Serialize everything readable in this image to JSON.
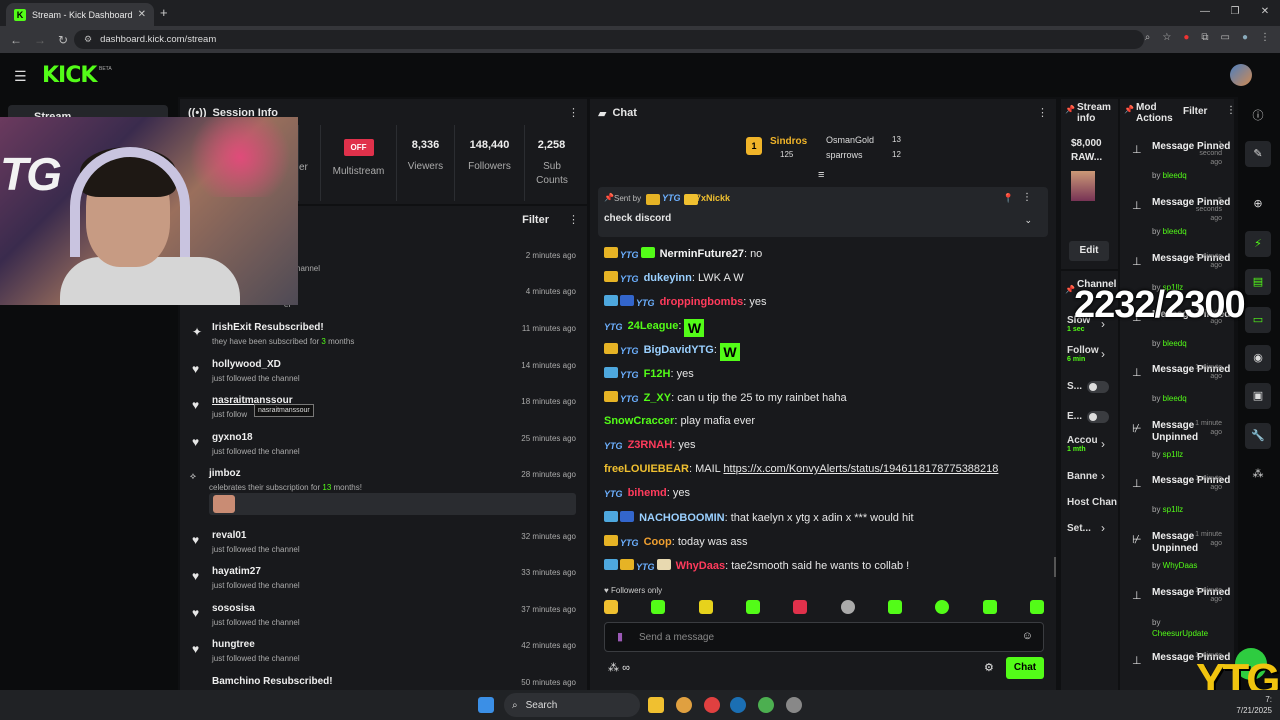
{
  "browser": {
    "tab_title": "Stream - Kick Dashboard",
    "url": "dashboard.kick.com/stream"
  },
  "header": {
    "logo": "KICK",
    "beta": "BETA"
  },
  "nav": {
    "stream": "Stream"
  },
  "webcam": {
    "overlay_text": "TG"
  },
  "session": {
    "title": "Session Info",
    "clipped_label": "er",
    "multistream_badge": "OFF",
    "multistream": "Multistream",
    "viewers": "8,336",
    "viewers_label": "Viewers",
    "followers": "148,440",
    "followers_label": "Followers",
    "subs": "2,258",
    "subs_label": "Sub Counts"
  },
  "activity": {
    "filter": "Filter",
    "events": [
      {
        "name": "",
        "sub": "channel",
        "time": "2 minutes ago"
      },
      {
        "name": "",
        "sub": "el",
        "time": "4 minutes ago"
      },
      {
        "name": "IrishExit Resubscribed!",
        "sub_pre": "they have been subscribed for ",
        "sub_num": "3",
        "sub_post": " months",
        "time": "11 minutes ago"
      },
      {
        "name": "hollywood_XD",
        "sub": "just followed the channel",
        "time": "14 minutes ago"
      },
      {
        "name": "nasraitmanssour",
        "sub": "just follow",
        "time": "18 minutes ago"
      },
      {
        "name": "gyxno18",
        "sub": "just followed the channel",
        "time": "25 minutes ago"
      },
      {
        "name": "jimboz",
        "sub_pre": "celebrates their subscription for ",
        "sub_num": "13",
        "sub_post": " months!",
        "time": "28 minutes ago"
      },
      {
        "name": "reval01",
        "sub": "just followed the channel",
        "time": "32 minutes ago"
      },
      {
        "name": "hayatim27",
        "sub": "just followed the channel",
        "time": "33 minutes ago"
      },
      {
        "name": "sososisa",
        "sub": "just followed the channel",
        "time": "37 minutes ago"
      },
      {
        "name": "hungtree",
        "sub": "just followed the channel",
        "time": "42 minutes ago"
      },
      {
        "name": "Bamchino Resubscribed!",
        "sub": "",
        "time": "50 minutes ago"
      }
    ],
    "tooltip": "nasraitmanssour"
  },
  "chat": {
    "title": "Chat",
    "top": {
      "first": "Sindros",
      "first_count": "125",
      "second": "OsmanGold",
      "second_count": "13",
      "third": "sparrows",
      "third_count": "12",
      "medal": "1"
    },
    "pinned": {
      "sent_by": "Sent by",
      "user": "7xNickk",
      "text": "check discord"
    },
    "messages": [
      {
        "user": "NerminFuture27",
        "color": "#f5f5f5",
        "text": "no"
      },
      {
        "user": "dukeyinn",
        "color": "#9ad0ff",
        "text": "LWK A W"
      },
      {
        "user": "droppingbombs",
        "color": "#ff3b5c",
        "text": "yes"
      },
      {
        "user": "24League",
        "color": "#53fc18",
        "text": ""
      },
      {
        "user": "BigDavidYTG",
        "color": "#9ad0ff",
        "text": ""
      },
      {
        "user": "F12H",
        "color": "#53fc18",
        "text": "yes"
      },
      {
        "user": "Z_XY",
        "color": "#53fc18",
        "text": "can u tip the 25 to my rainbet haha"
      },
      {
        "user": "SnowCraccer",
        "color": "#53fc18",
        "text": "play mafia ever"
      },
      {
        "user": "Z3RNAH",
        "color": "#ff3b5c",
        "text": "yes"
      },
      {
        "user": "freeLOUIEBEAR",
        "color": "#f0c030",
        "text": "MAIL ",
        "link": "https://x.com/KonvyAlerts/status/1946118178775388218"
      },
      {
        "user": "bihemd",
        "color": "#ff3b5c",
        "text": "yes"
      },
      {
        "user": "NACHOBOOMIN",
        "color": "#9ad0ff",
        "text": "that kaelyn x ytg x adin x *** would hit"
      },
      {
        "user": "Coop",
        "color": "#f0a030",
        "text": "today was ass"
      },
      {
        "user": "WhyDaas",
        "color": "#ff3b5c",
        "text": "tae2smooth said he wants to collab !"
      }
    ],
    "emote_w": "W",
    "followers_only": "Followers only",
    "placeholder": "Send a message",
    "send": "Chat",
    "inf": "∞"
  },
  "stream_info": {
    "title": "Stream info",
    "clipped_title": "$8,000 RAW...",
    "edit": "Edit"
  },
  "channel": {
    "title": "Channel",
    "rows": [
      {
        "label": "Slow",
        "value": "1 sec"
      },
      {
        "label": "Follow",
        "value": "6 min"
      },
      {
        "label": "S..."
      },
      {
        "label": "E..."
      },
      {
        "label": "Accou",
        "value": "1 mth"
      },
      {
        "label": "Banne"
      },
      {
        "label": "Host Chan"
      },
      {
        "label": "Set..."
      }
    ]
  },
  "mod": {
    "title": "Mod Actions",
    "filter": "Filter",
    "items": [
      {
        "action": "Message Pinned",
        "by": "bleedq",
        "time": "1 second ago"
      },
      {
        "action": "Message Pinned",
        "by": "bleedq",
        "time": "5 seconds ago"
      },
      {
        "action": "Message Pinned",
        "by": "sp1llz",
        "time": "1 minute ago"
      },
      {
        "action": "Message Pinned",
        "by": "bleedq",
        "time": "1 minute ago"
      },
      {
        "action": "Message Pinned",
        "by": "bleedq",
        "time": "1 minute ago"
      },
      {
        "action": "Message Unpinned",
        "by": "sp1llz",
        "time": "1 minute ago"
      },
      {
        "action": "Message Pinned",
        "by": "sp1llz",
        "time": "1 minute ago"
      },
      {
        "action": "Message Unpinned",
        "by": "WhyDaas",
        "time": "1 minute ago"
      },
      {
        "action": "Message Pinned",
        "by": "CheesurUpdate",
        "time": "1 minute ago"
      },
      {
        "action": "Message Pinned",
        "by": "",
        "time": "1 minute"
      }
    ]
  },
  "overlay": {
    "counter": "2232/2300",
    "logo": "YTG"
  },
  "taskbar": {
    "search": "Search",
    "time": "7:",
    "date": "7/21/2025"
  },
  "colors": {
    "accent": "#53fc18",
    "bg": "#0b0c0d",
    "panel": "#18191c"
  }
}
